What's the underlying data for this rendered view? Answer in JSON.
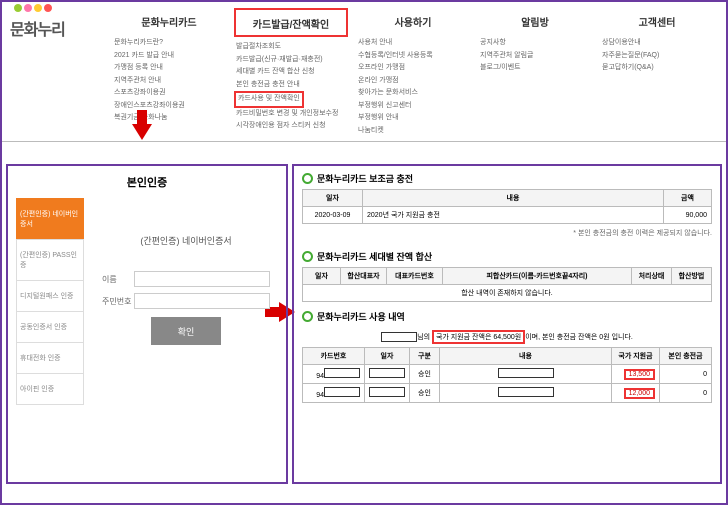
{
  "logo_text": "문화누리",
  "nav": {
    "cols": [
      {
        "title": "문화누리카드",
        "items": [
          "문화누리카드란?",
          "2021 카드 발급 안내",
          "가맹점 등록 안내",
          "지역주관처 안내",
          "스포츠강좌이용권",
          "장애인스포츠강좌이용권",
          "복권기금 문화나눔"
        ],
        "boxed_title": false
      },
      {
        "title": "카드발급/잔액확인",
        "items": [
          "발급절차조회도",
          "카드발급(신규·재발급·재충전)",
          "세대별 카드 잔액 합산 신청",
          "본인 충전금 충전 안내",
          "카드사용 및 잔액확인",
          "카드비밀번호 변경 및 개인정보수정",
          "시각장애인용 점자 스티커 신청"
        ],
        "boxed_title": true,
        "boxed_index": 4
      },
      {
        "title": "사용하기",
        "items": [
          "사용처 안내",
          "수협등록/인터넷 사용등록",
          "오프라인 가맹점",
          "온라인 가맹점",
          "찾아가는 문화서비스",
          "부정행위 신고센터",
          "부정행위 안내",
          "나눔티켓"
        ],
        "boxed_title": false
      },
      {
        "title": "알림방",
        "items": [
          "공지사항",
          "지역주관처 알림글",
          "블로그/이벤트"
        ],
        "boxed_title": false
      },
      {
        "title": "고객센터",
        "items": [
          "상담이용안내",
          "자주묻는질문(FAQ)",
          "묻고답하기(Q&A)"
        ],
        "boxed_title": false
      }
    ]
  },
  "auth": {
    "title": "본인인증",
    "tabs": [
      "(간편인증) 네이버인증서",
      "(간편인증) PASS인증",
      "디지털원패스 인증",
      "공동인증서 인증",
      "휴대전화 인증",
      "아이핀 인증"
    ],
    "form_title": "(간편인증) 네이버인증서",
    "name_label": "이름",
    "jumin_label": "주민번호",
    "confirm": "확인"
  },
  "content": {
    "section1": {
      "title": "문화누리카드 보조금 충전",
      "cols": [
        "일자",
        "내용",
        "금액"
      ],
      "row": {
        "date": "2020-03-09",
        "desc": "2020년 국가 지원금 충전",
        "amt": "90,000"
      },
      "note": "* 본인 충전금의 충전 이력은 제공되지 않습니다."
    },
    "section2": {
      "title": "문화누리카드 세대별 잔액 합산",
      "cols": [
        "일자",
        "합산대표자",
        "대표카드번호",
        "피합산카드(이름-카드번호끝4자리)",
        "처리상태",
        "합산방법"
      ],
      "empty": "합산 내역이 존재하지 않습니다."
    },
    "section3": {
      "title": "문화누리카드 사용 내역",
      "balance_prefix": "님의 ",
      "balance_highlight": "국가 지원금 잔액은 64,500원",
      "balance_mid": "이며, 본인 충전금 잔액은 0원 입니다.",
      "cols": [
        "카드번호",
        "일자",
        "구분",
        "내용",
        "국가 지원금",
        "본인 충전금"
      ],
      "rows": [
        {
          "card_prefix": "94",
          "type": "승인",
          "gov": "13,500",
          "own": "0"
        },
        {
          "card_prefix": "94",
          "type": "승인",
          "gov": "12,000",
          "own": "0"
        }
      ]
    }
  }
}
